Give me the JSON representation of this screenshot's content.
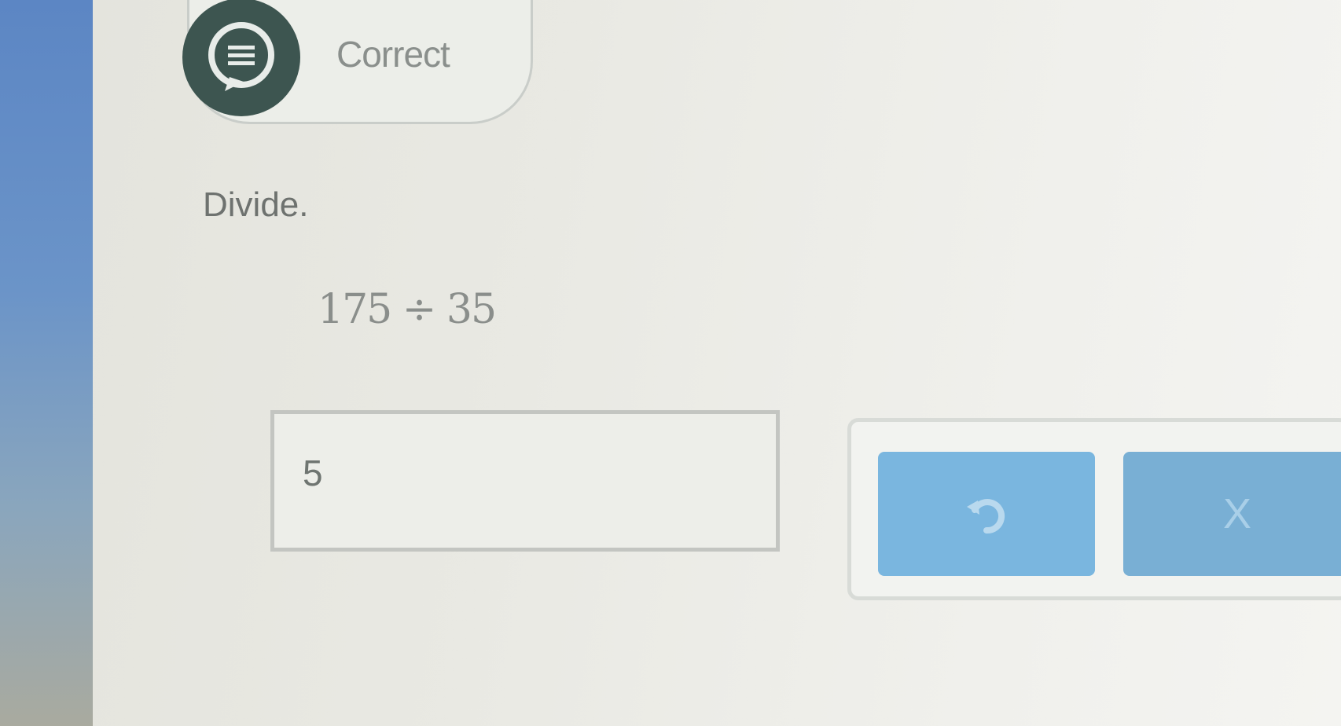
{
  "feedback": {
    "label": "Correct",
    "icon": "chat-bubble-icon"
  },
  "question": {
    "prompt": "Divide.",
    "equation": "175 ÷ 35"
  },
  "answer": {
    "value": "5"
  },
  "keypad": {
    "undo_icon": "undo-arrow-icon",
    "clear_label": "X"
  }
}
